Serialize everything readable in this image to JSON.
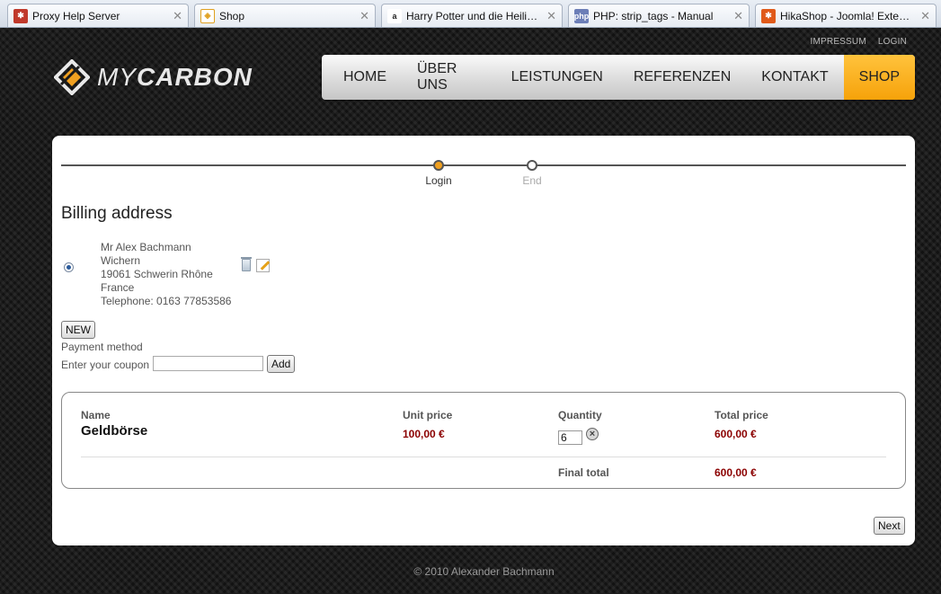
{
  "browser": {
    "tabs": [
      {
        "title": "Proxy Help Server",
        "favicon": "joomla-icon",
        "color": "#c0392b"
      },
      {
        "title": "Shop",
        "favicon": "loading-icon",
        "color": "#e0a020"
      },
      {
        "title": "Harry Potter und die Heiligt...",
        "favicon": "amazon-icon",
        "color": "#222222"
      },
      {
        "title": "PHP: strip_tags - Manual",
        "favicon": "php-icon",
        "color": "#6c7eb7"
      },
      {
        "title": "HikaShop - Joomla! Extensi...",
        "favicon": "joomla-icon",
        "color": "#e05a1a"
      }
    ],
    "close_glyph": "✕"
  },
  "header": {
    "top_links": [
      "IMPRESSUM",
      "LOGIN"
    ],
    "logo": {
      "prefix": "MY",
      "suffix": "CARBON"
    },
    "nav": [
      "HOME",
      "ÜBER UNS",
      "LEISTUNGEN",
      "REFERENZEN",
      "KONTAKT",
      "SHOP"
    ],
    "active_nav": "SHOP",
    "accent_color": "#f6a20a"
  },
  "checkout": {
    "steps": [
      {
        "label": "Login",
        "active": true
      },
      {
        "label": "End",
        "active": false
      }
    ],
    "billing_title": "Billing address",
    "address_lines": [
      "Mr Alex Bachmann",
      "Wichern",
      "19061 Schwerin Rhône",
      "France",
      "Telephone: 0163 77853586"
    ],
    "new_button": "NEW",
    "payment_method_label": "Payment method",
    "coupon_label": "Enter your coupon",
    "coupon_value": "",
    "add_button": "Add",
    "cart": {
      "columns": {
        "name": "Name",
        "unit_price": "Unit price",
        "quantity": "Quantity",
        "total_price": "Total price"
      },
      "item": {
        "name": "Geldbörse",
        "unit_price": "100,00 €",
        "quantity": "6",
        "total_price": "600,00 €"
      },
      "final_total_label": "Final total",
      "final_total_value": "600,00 €",
      "price_color": "#8b0000"
    },
    "next_button": "Next"
  },
  "footer": {
    "copyright": "© 2010 Alexander Bachmann"
  }
}
